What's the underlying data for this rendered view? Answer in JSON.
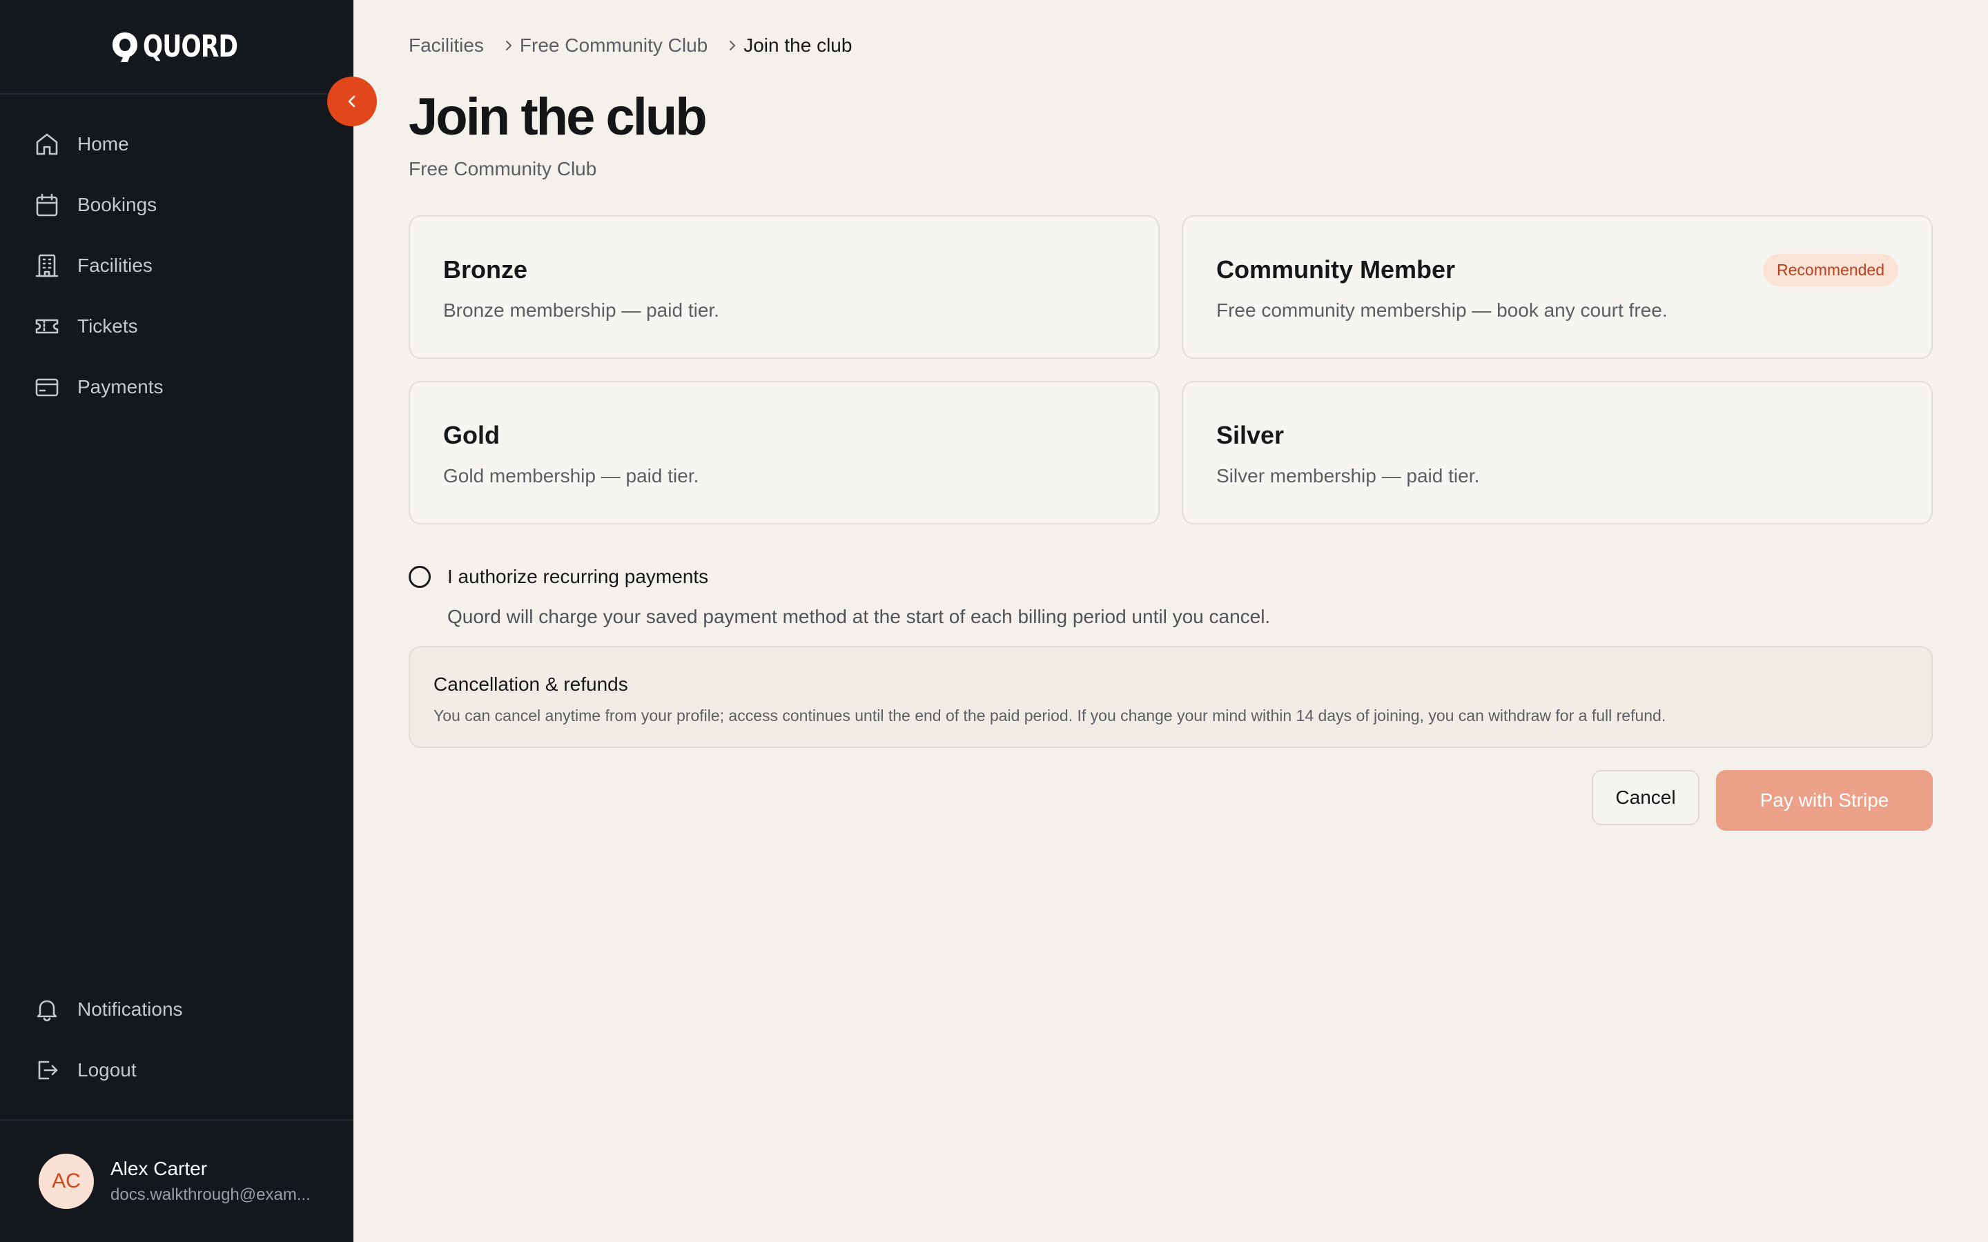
{
  "brand": {
    "name": "QUORD"
  },
  "sidebar": {
    "nav_items": [
      {
        "label": "Home",
        "icon": "home-icon"
      },
      {
        "label": "Bookings",
        "icon": "calendar-icon"
      },
      {
        "label": "Facilities",
        "icon": "building-icon"
      },
      {
        "label": "Tickets",
        "icon": "ticket-icon"
      },
      {
        "label": "Payments",
        "icon": "credit-card-icon"
      }
    ],
    "bottom_items": [
      {
        "label": "Notifications",
        "icon": "bell-icon"
      },
      {
        "label": "Logout",
        "icon": "logout-icon"
      }
    ],
    "user": {
      "initials": "AC",
      "name": "Alex Carter",
      "email": "docs.walkthrough@exam..."
    },
    "collapse_icon": "chevron-left-icon"
  },
  "breadcrumb": {
    "items": [
      "Facilities",
      "Free Community Club",
      "Join the club"
    ]
  },
  "page": {
    "title": "Join the club",
    "subtitle": "Free Community Club"
  },
  "tiers": [
    {
      "name": "Bronze",
      "description": "Bronze membership — paid tier."
    },
    {
      "name": "Community Member",
      "description": "Free community membership — book any court free.",
      "badge": "Recommended"
    },
    {
      "name": "Gold",
      "description": "Gold membership — paid tier."
    },
    {
      "name": "Silver",
      "description": "Silver membership — paid tier."
    }
  ],
  "authorize": {
    "label": "I authorize recurring payments",
    "description": "Quord will charge your saved payment method at the start of each billing period until you cancel.",
    "checked": false
  },
  "refunds": {
    "title": "Cancellation & refunds",
    "text": "You can cancel anytime from your profile; access continues until the end of the paid period. If you change your mind within 14 days of joining, you can withdraw for a full refund."
  },
  "actions": {
    "cancel_label": "Cancel",
    "pay_label": "Pay with Stripe"
  },
  "colors": {
    "sidebar_bg": "#14171c",
    "page_bg": "#f4f1ec",
    "accent": "#e2461b",
    "pay_button_disabled": "#eda088",
    "badge_bg": "#fbe2d6",
    "badge_text": "#b8401b"
  }
}
